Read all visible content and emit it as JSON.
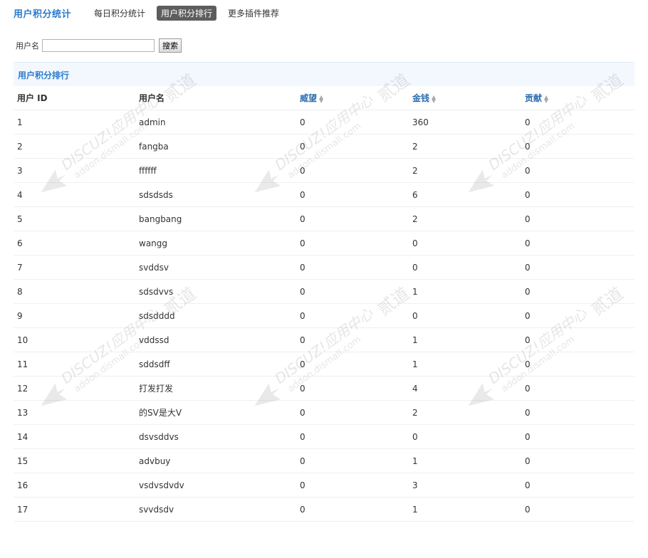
{
  "header": {
    "title": "用户积分统计",
    "tabs": [
      {
        "label": "每日积分统计",
        "active": false
      },
      {
        "label": "用户积分排行",
        "active": true
      },
      {
        "label": "更多插件推荐",
        "active": false
      }
    ]
  },
  "search": {
    "label": "用户名",
    "value": "",
    "button_label": "搜索"
  },
  "section": {
    "title": "用户积分排行"
  },
  "table": {
    "columns": {
      "id": "用户 ID",
      "name": "用户名",
      "weiwang": "威望",
      "money": "金钱",
      "contribution": "贡献"
    },
    "rows": [
      {
        "id": "1",
        "name": "admin",
        "weiwang": "0",
        "money": "360",
        "contribution": "0"
      },
      {
        "id": "2",
        "name": "fangba",
        "weiwang": "0",
        "money": "2",
        "contribution": "0"
      },
      {
        "id": "3",
        "name": "ffffff",
        "weiwang": "0",
        "money": "2",
        "contribution": "0"
      },
      {
        "id": "4",
        "name": "sdsdsds",
        "weiwang": "0",
        "money": "6",
        "contribution": "0"
      },
      {
        "id": "5",
        "name": "bangbang",
        "weiwang": "0",
        "money": "2",
        "contribution": "0"
      },
      {
        "id": "6",
        "name": "wangg",
        "weiwang": "0",
        "money": "0",
        "contribution": "0"
      },
      {
        "id": "7",
        "name": "svddsv",
        "weiwang": "0",
        "money": "0",
        "contribution": "0"
      },
      {
        "id": "8",
        "name": "sdsdvvs",
        "weiwang": "0",
        "money": "1",
        "contribution": "0"
      },
      {
        "id": "9",
        "name": "sdsdddd",
        "weiwang": "0",
        "money": "0",
        "contribution": "0"
      },
      {
        "id": "10",
        "name": "vddssd",
        "weiwang": "0",
        "money": "1",
        "contribution": "0"
      },
      {
        "id": "11",
        "name": "sddsdff",
        "weiwang": "0",
        "money": "1",
        "contribution": "0"
      },
      {
        "id": "12",
        "name": "打发打发",
        "weiwang": "0",
        "money": "4",
        "contribution": "0"
      },
      {
        "id": "13",
        "name": "的SV是大V",
        "weiwang": "0",
        "money": "2",
        "contribution": "0"
      },
      {
        "id": "14",
        "name": "dsvsddvs",
        "weiwang": "0",
        "money": "0",
        "contribution": "0"
      },
      {
        "id": "15",
        "name": "advbuy",
        "weiwang": "0",
        "money": "1",
        "contribution": "0"
      },
      {
        "id": "16",
        "name": "vsdvsdvdv",
        "weiwang": "0",
        "money": "3",
        "contribution": "0"
      },
      {
        "id": "17",
        "name": "svvdsdv",
        "weiwang": "0",
        "money": "1",
        "contribution": "0"
      }
    ]
  },
  "watermark": {
    "line1": "DISCUZ!应用中心",
    "line2": "addon.dismall.com",
    "mark": "贰道"
  },
  "colors": {
    "accent": "#2b7acd",
    "active_tab_bg": "#5d5d5d",
    "section_bg": "#f2f8fe"
  }
}
